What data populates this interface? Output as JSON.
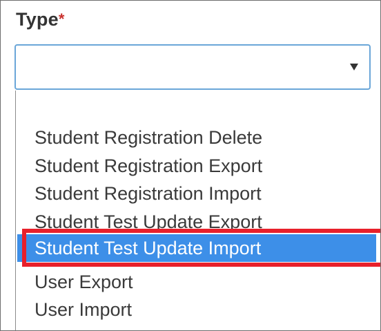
{
  "field": {
    "label": "Type",
    "required_marker": "*",
    "selected_value": ""
  },
  "dropdown": {
    "options": [
      "Student Registration Delete",
      "Student Registration Export",
      "Student Registration Import",
      "Student Test Update Export",
      "Student Test Update Import",
      "User Export",
      "User Import"
    ],
    "highlighted_index": 4
  },
  "colors": {
    "selection": "#3d8fe8",
    "annotation": "#e8202b",
    "focus_border": "#6aa6d8"
  }
}
